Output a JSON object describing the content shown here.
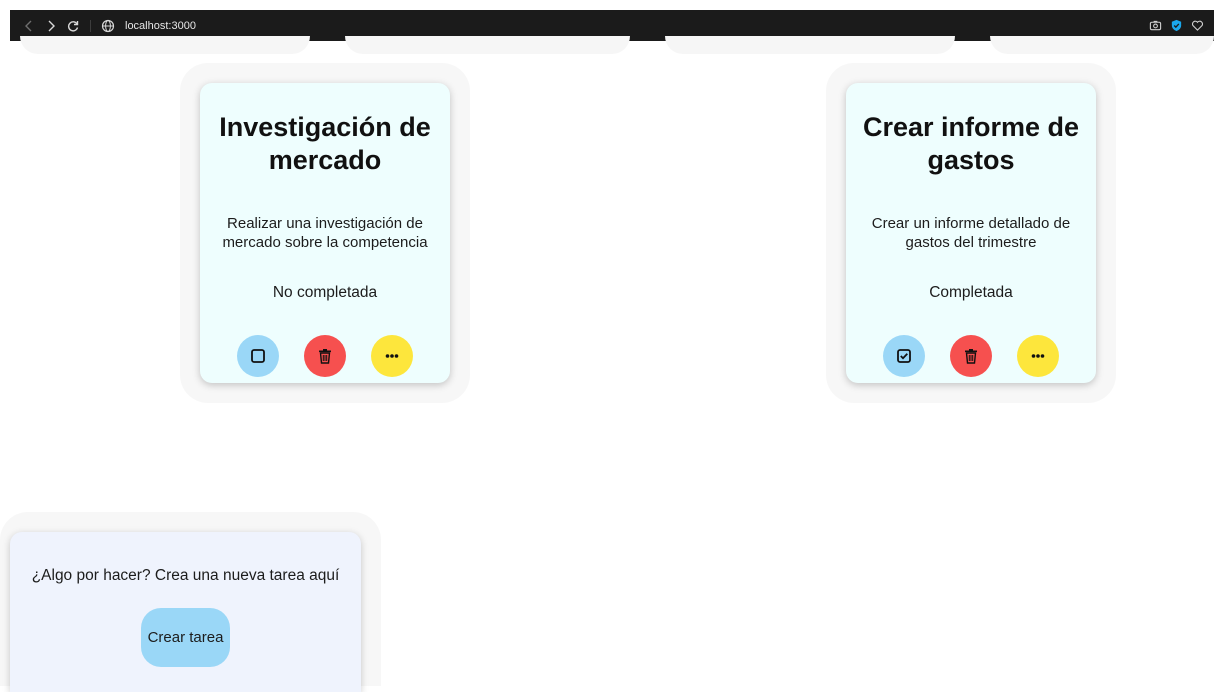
{
  "browser": {
    "url": "localhost:3000",
    "accent": "#1aa7ec"
  },
  "tasks": [
    {
      "title": "Investigación de mercado",
      "description": "Realizar una investigación de mercado sobre la competencia",
      "status": "No completada",
      "completed": false
    },
    {
      "title": "Crear informe de gastos",
      "description": "Crear un informe detallado de gastos del trimestre",
      "status": "Completada",
      "completed": true
    }
  ],
  "create": {
    "prompt": "¿Algo por hacer? Crea una nueva tarea aquí",
    "button_label": "Crear tarea"
  },
  "colors": {
    "toggle": "#9ad7f7",
    "delete": "#f6504f",
    "more": "#fde63c",
    "card_bg": "#eefefe",
    "create_bg": "#eff3fd"
  }
}
